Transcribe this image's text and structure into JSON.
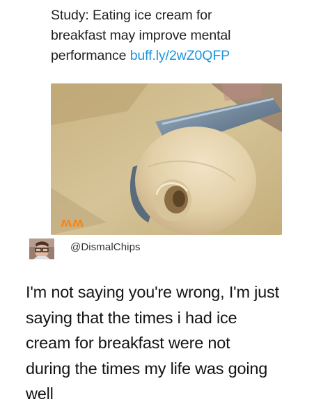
{
  "original_tweet": {
    "lines": [
      "Study: Eating ice cream for",
      "breakfast may improve mental",
      "performance "
    ],
    "link": "buff.ly/2wZ0QFP"
  },
  "photo": {
    "watermark": "ʍʍ",
    "colors": {
      "background": "#cdb98c",
      "ice_cream": "#e7d6b2",
      "scoop": "#7f95a8",
      "watermark": "#f08a1e"
    }
  },
  "reply": {
    "handle": "@DismalChips",
    "lines": [
      "I'm not saying you're wrong, I'm just",
      "saying that the times i had ice",
      "cream for breakfast were not",
      "during the times my life was going",
      "well"
    ]
  }
}
